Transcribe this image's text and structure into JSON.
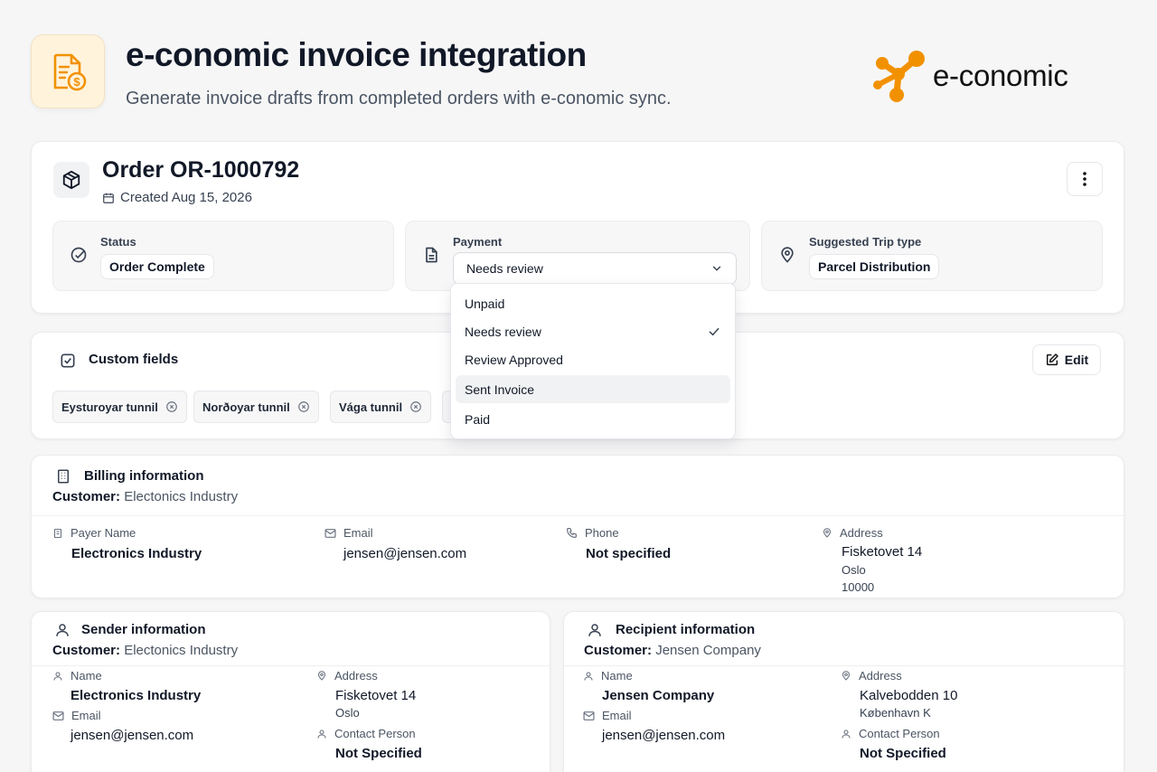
{
  "header": {
    "title": "e-conomic invoice integration",
    "subtitle": "Generate invoice drafts from completed orders with e-conomic sync.",
    "brand": "e-conomic",
    "brand_color": "#f29100"
  },
  "order": {
    "title": "Order OR-1000792",
    "created": "Created Aug 15, 2026",
    "status": {
      "label": "Status",
      "value": "Order Complete"
    },
    "payment": {
      "label": "Payment",
      "value": "Needs review"
    },
    "trip": {
      "label": "Suggested Trip type",
      "value": "Parcel Distribution"
    }
  },
  "payment_menu": {
    "options": [
      "Unpaid",
      "Needs review",
      "Review Approved",
      "Sent Invoice",
      "Paid"
    ],
    "selected": "Needs review",
    "highlighted": "Sent Invoice"
  },
  "custom_fields": {
    "title": "Custom fields",
    "edit_label": "Edit",
    "tags": [
      "Eysturoyar tunnil",
      "Norðoyar tunnil",
      "Vága tunnil"
    ]
  },
  "billing": {
    "title": "Billing information",
    "customer_label": "Customer:",
    "customer": "Electonics Industry",
    "payer_label": "Payer Name",
    "payer": "Electronics Industry",
    "email_label": "Email",
    "email": "jensen@jensen.com",
    "phone_label": "Phone",
    "phone": "Not specified",
    "address_label": "Address",
    "address_line1": "Fisketovet 14",
    "address_city": "Oslo",
    "address_zip": "10000"
  },
  "sender": {
    "title": "Sender information",
    "customer_label": "Customer:",
    "customer": "Electonics Industry",
    "name_label": "Name",
    "name": "Electronics Industry",
    "email_label": "Email",
    "email": "jensen@jensen.com",
    "address_label": "Address",
    "address_line1": "Fisketovet 14",
    "address_city": "Oslo",
    "contact_label": "Contact Person",
    "contact": "Not Specified"
  },
  "recipient": {
    "title": "Recipient information",
    "customer_label": "Customer:",
    "customer": "Jensen Company",
    "name_label": "Name",
    "name": "Jensen Company",
    "email_label": "Email",
    "email": "jensen@jensen.com",
    "address_label": "Address",
    "address_line1": "Kalvebodden 10",
    "address_city": "København K",
    "contact_label": "Contact Person",
    "contact": "Not Specified"
  }
}
